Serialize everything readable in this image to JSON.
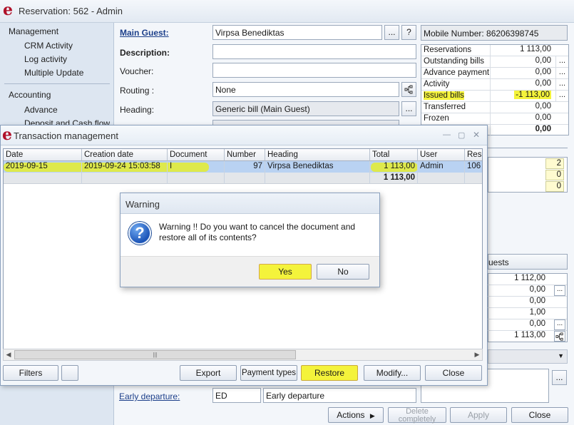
{
  "main": {
    "title": "Reservation: 562 - Admin",
    "sidebar": {
      "management": "Management",
      "crm_activity": "CRM Activity",
      "log_activity": "Log activity",
      "multiple_update": "Multiple Update",
      "accounting": "Accounting",
      "advance": "Advance",
      "deposit": "Deposit and Cash flows"
    },
    "labels": {
      "main_guest": "Main Guest:",
      "description": "Description:",
      "voucher": "Voucher:",
      "routing": "Routing :",
      "heading": "Heading:",
      "early_departure": "Early departure:"
    },
    "fields": {
      "main_guest": "Virpsa Benediktas",
      "routing": "None",
      "heading": "Generic bill (Main Guest)",
      "early_departure_code": "ED",
      "early_departure_text": "Early departure"
    },
    "buttons": {
      "ellipsis": "...",
      "question": "?",
      "actions": "Actions",
      "delete_completely": "Delete completely",
      "apply": "Apply",
      "close": "Close"
    },
    "mobile": "Mobile Number: 86206398745",
    "stats": [
      {
        "label": "Reservations",
        "value": "1 113,00"
      },
      {
        "label": "Outstanding bills",
        "value": "0,00"
      },
      {
        "label": "Advance payments",
        "value": "0,00"
      },
      {
        "label": "Activity",
        "value": "0,00"
      },
      {
        "label": "Issued bills",
        "value": "-1 113,00"
      },
      {
        "label": "Transferred",
        "value": "0,00"
      },
      {
        "label": "Frozen",
        "value": "0,00"
      },
      {
        "label": "",
        "value": "0,00"
      }
    ],
    "counts": [
      "2",
      "0",
      "0"
    ],
    "guests_tab": "uests",
    "guest_values": [
      "1 112,00",
      "0,00",
      "0,00",
      "1,00",
      "0,00",
      "1 113,00"
    ]
  },
  "tx": {
    "title": "Transaction management",
    "columns": [
      "Date",
      "Creation date",
      "Document",
      "Number",
      "Heading",
      "Total",
      "User",
      "Rese"
    ],
    "row": {
      "date": "2019-09-15",
      "creation": "2019-09-24 15:03:58",
      "document": "I",
      "number": "97",
      "heading": "Virpsa Benediktas",
      "total": "1 113,00",
      "user": "Admin",
      "rese": "106"
    },
    "total_row": "1 113,00",
    "buttons": {
      "filters": "Filters",
      "export": "Export",
      "payment_types": "Payment types",
      "restore": "Restore",
      "modify": "Modify...",
      "close": "Close"
    }
  },
  "warning": {
    "title": "Warning",
    "message": "Warning !! Do you want to cancel the document and restore all of its contents?",
    "yes": "Yes",
    "no": "No"
  },
  "colors": {
    "highlight": "#f4f33b",
    "selection": "#b9d2f2",
    "logo": "#b0122a"
  }
}
